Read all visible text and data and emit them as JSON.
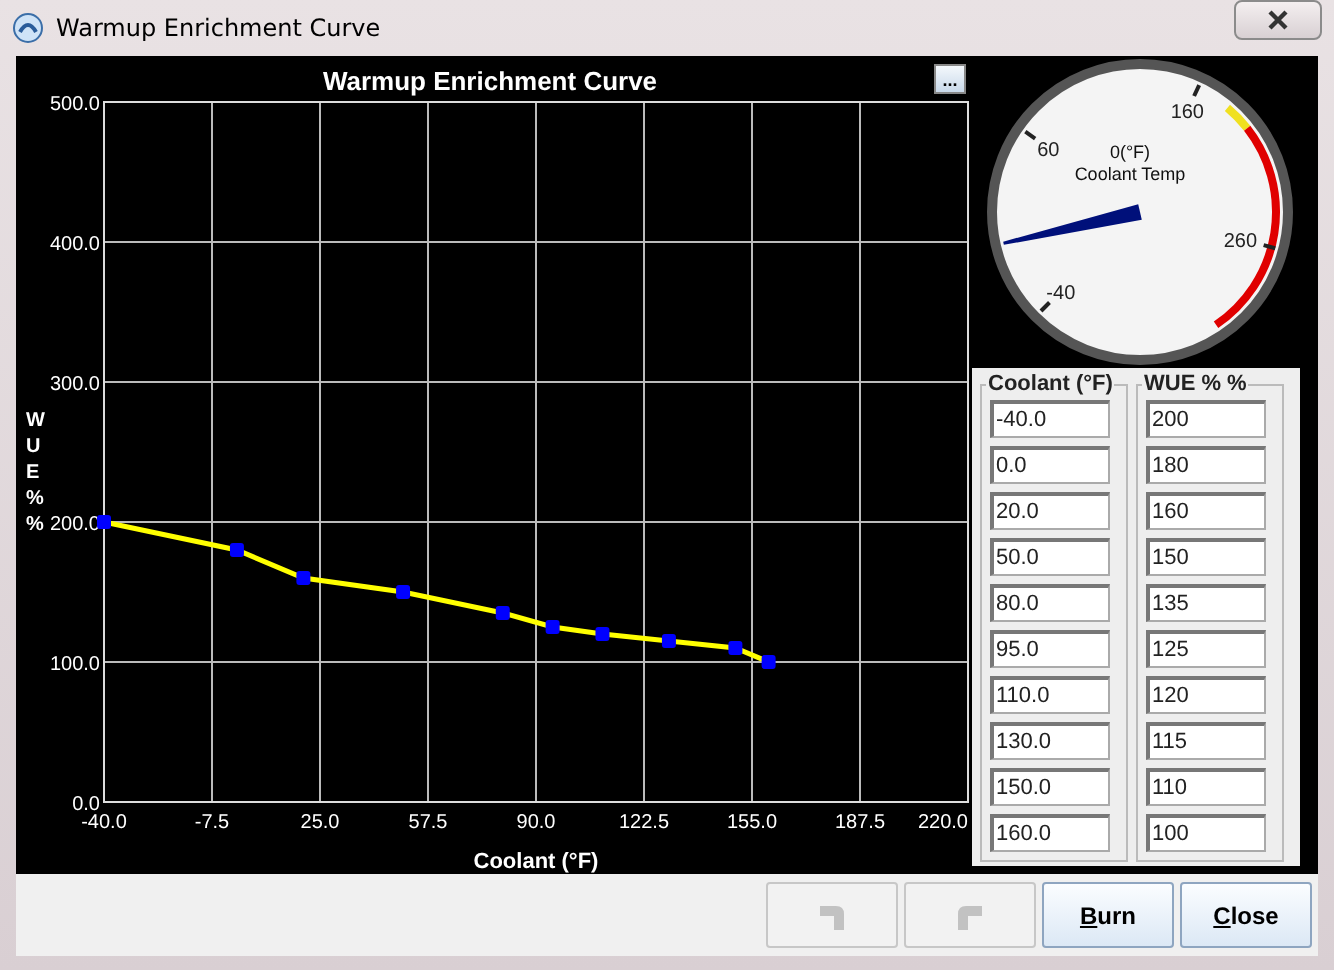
{
  "window": {
    "title": "Warmup Enrichment Curve"
  },
  "chart": {
    "menu_button": "...",
    "chart_data": {
      "type": "line",
      "title": "Warmup Enrichment Curve",
      "xlabel": "Coolant (°F)",
      "ylabel": "WUE % %",
      "x": [
        -40,
        0,
        20,
        50,
        80,
        95,
        110,
        130,
        150,
        160
      ],
      "grid": true,
      "series": [
        {
          "color": "#ffff00",
          "marker": true,
          "values": [
            200,
            180,
            160,
            150,
            135,
            125,
            120,
            115,
            110,
            100
          ]
        }
      ],
      "xlim": [
        -40,
        220
      ],
      "ylim": [
        0,
        500
      ],
      "xticks": [
        {
          "value": -40,
          "label": "-40.0"
        },
        {
          "value": -7.5,
          "label": "-7.5"
        },
        {
          "value": 25,
          "label": "25.0"
        },
        {
          "value": 57.5,
          "label": "57.5"
        },
        {
          "value": 90,
          "label": "90.0"
        },
        {
          "value": 122.5,
          "label": "122.5"
        },
        {
          "value": 155,
          "label": "155.0"
        },
        {
          "value": 187.5,
          "label": "187.5"
        },
        {
          "value": 220,
          "label": "220.0"
        }
      ],
      "yticks": [
        {
          "value": 0,
          "label": "0.0"
        },
        {
          "value": 100,
          "label": "100.0"
        },
        {
          "value": 200,
          "label": "200.0"
        },
        {
          "value": 300,
          "label": "300.0"
        },
        {
          "value": 400,
          "label": "400.0"
        },
        {
          "value": 500,
          "label": "500.0"
        }
      ]
    }
  },
  "gauge": {
    "reading": "0(°F)",
    "label": "Coolant Temp",
    "level": 0.118,
    "ticks": [
      "-40",
      "60",
      "160",
      "260"
    ]
  },
  "table": {
    "columns": [
      {
        "header": "Coolant (°F)",
        "values": [
          "-40.0",
          "0.0",
          "20.0",
          "50.0",
          "80.0",
          "95.0",
          "110.0",
          "130.0",
          "150.0",
          "160.0"
        ]
      },
      {
        "header": "WUE % %",
        "values": [
          "200",
          "180",
          "160",
          "150",
          "135",
          "125",
          "120",
          "115",
          "110",
          "100"
        ]
      }
    ]
  },
  "buttons": [
    {
      "kind": "undo",
      "disabled": true
    },
    {
      "kind": "redo",
      "disabled": true
    },
    {
      "kind": "text",
      "label": "Burn",
      "disabled": false
    },
    {
      "kind": "text",
      "label": "Close",
      "disabled": false
    }
  ]
}
